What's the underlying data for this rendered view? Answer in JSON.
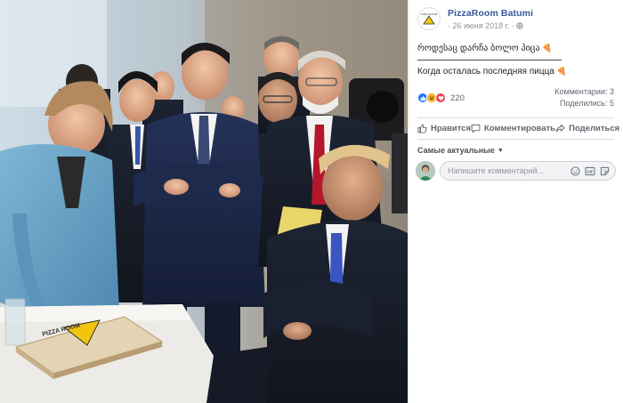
{
  "post": {
    "page_name": "PizzaRoom Batumi",
    "date": "· 26 июня 2018 г. ·",
    "text_line1": "როდესაც დარჩა ბოლო პიცა",
    "text_line2": "Когда осталась последняя пицца",
    "pizza_emoji": "🍕",
    "logo_text": "PIZZA ROOM"
  },
  "stats": {
    "reaction_count": "220",
    "comments": "Комментарии: 3",
    "shares": "Поделились: 5",
    "reactions": [
      "like-icon",
      "haha-icon",
      "love-icon"
    ],
    "colors": {
      "like": "#2078f4",
      "haha": "#f7b125",
      "love": "#f33e58"
    }
  },
  "actions": {
    "like_label": "Нравится",
    "comment_label": "Комментировать",
    "share_label": "Поделиться"
  },
  "comments": {
    "sort_label": "Самые актуальные",
    "input_placeholder": "Напишите комментарий..."
  },
  "photo": {
    "box_label": "PIZZA ROOM"
  },
  "colors": {
    "brand_link": "#385898",
    "muted": "#90949c",
    "text": "#1d2129"
  }
}
